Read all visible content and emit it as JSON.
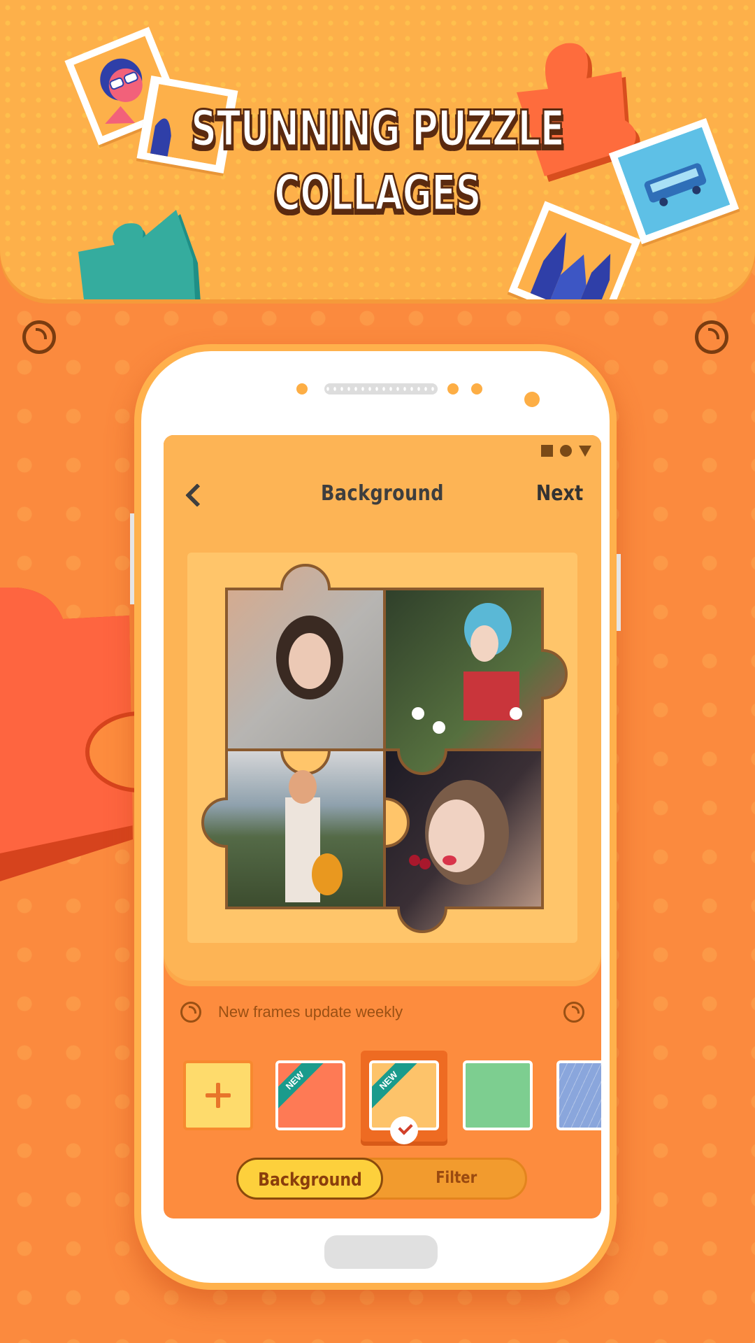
{
  "banner": {
    "headline_line1": "STUNNING PUZZLE",
    "headline_line2": "COLLAGES"
  },
  "colors": {
    "background": "#fb8a3e",
    "banner": "#fdb04a",
    "accent_yellow": "#fdd03c",
    "ribbon_teal": "#1a9b8c",
    "text_dark": "#3e3e3e"
  },
  "status_bar": {
    "icons": [
      "square-icon",
      "circle-icon",
      "triangle-icon"
    ]
  },
  "topbar": {
    "back_icon": "chevron-left-icon",
    "title": "Background",
    "next_label": "Next"
  },
  "collage": {
    "pieces": [
      {
        "position": "top-left",
        "description": "Girl in grey hoodie with hands above head"
      },
      {
        "position": "top-right",
        "description": "Girl with blue hair among daisies"
      },
      {
        "position": "bottom-left",
        "description": "Girl in white outfit at seaside"
      },
      {
        "position": "bottom-right",
        "description": "Girl holding cherries"
      }
    ]
  },
  "update_notice": "New frames update weekly",
  "swatches": [
    {
      "type": "add",
      "label": "+",
      "color": "#fedb6c"
    },
    {
      "type": "color",
      "color": "#fe7a55",
      "badge": "NEW",
      "selected": false
    },
    {
      "type": "color",
      "color": "#fdc36a",
      "badge": "NEW",
      "selected": true
    },
    {
      "type": "color",
      "color": "#7dce90",
      "badge": null,
      "selected": false
    },
    {
      "type": "pattern",
      "color": "#8aa6dc",
      "badge": null,
      "selected": false
    }
  ],
  "segmented": {
    "options": [
      "Background",
      "Filter"
    ],
    "selected": "Background"
  }
}
